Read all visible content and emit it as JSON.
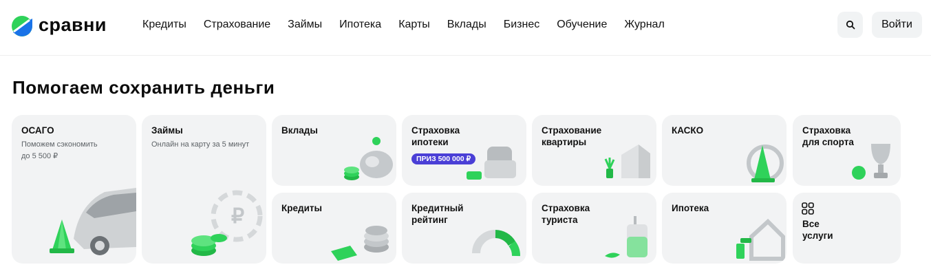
{
  "header": {
    "logo_text": "сравни",
    "nav": [
      "Кредиты",
      "Страхование",
      "Займы",
      "Ипотека",
      "Карты",
      "Вклады",
      "Бизнес",
      "Обучение",
      "Журнал"
    ],
    "search_icon": "search-icon",
    "login_label": "Войти"
  },
  "main": {
    "title": "Помогаем сохранить деньги",
    "cards": {
      "osago": {
        "title": "ОСАГО",
        "subtitle": "Поможем сэкономить\nдо 5 500 ₽"
      },
      "zaimy": {
        "title": "Займы",
        "subtitle": "Онлайн на карту за 5 минут"
      },
      "vklady": {
        "title": "Вклады"
      },
      "strahovka_ipoteki": {
        "title": "Страховка\nипотеки",
        "badge": "ПРИЗ 500 000 ₽"
      },
      "strahovanie_kvartiry": {
        "title": "Страхование\nквартиры"
      },
      "kasko": {
        "title": "КАСКО"
      },
      "strahovka_sport": {
        "title": "Страховка\nдля спорта"
      },
      "kredity": {
        "title": "Кредиты"
      },
      "kreditny_reiting": {
        "title": "Кредитный\n рейтинг"
      },
      "strahovka_turista": {
        "title": "Страховка\nтуриста"
      },
      "ipoteka": {
        "title": "Ипотека"
      },
      "vse_uslugi": {
        "title": "Все\nуслуги",
        "icon": "grid-icon"
      }
    }
  },
  "colors": {
    "accent_green": "#2fd25a",
    "badge_purple": "#4a3fd6",
    "card_bg": "#f2f3f4"
  }
}
